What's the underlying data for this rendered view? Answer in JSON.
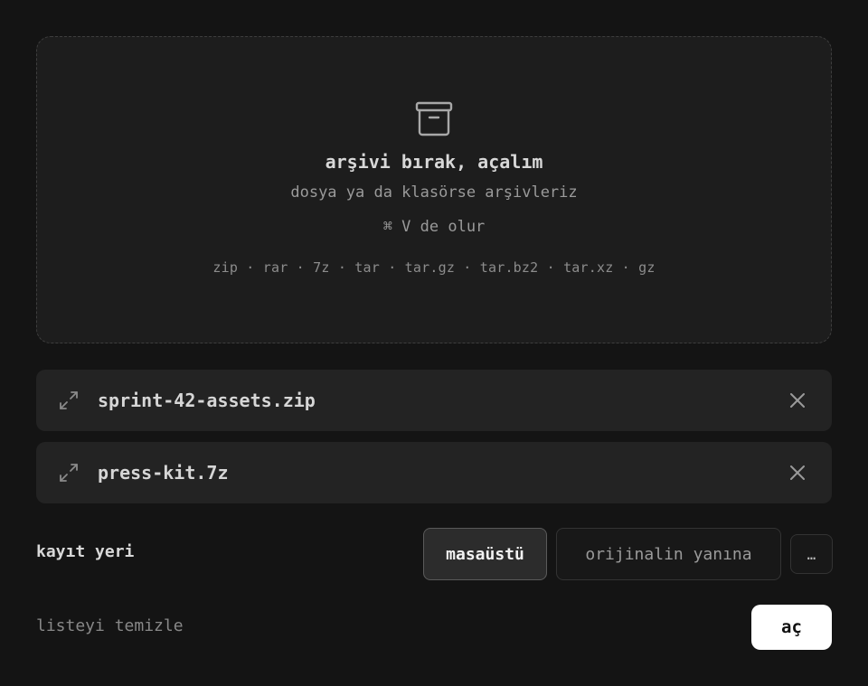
{
  "dropzone": {
    "icon": "archive-box-icon",
    "title": "arşivi bırak, açalım",
    "subtitle": "dosya ya da klasörse arşivleriz",
    "paste_hint": "⌘ V de olur",
    "formats": "zip · rar · 7z · tar · tar.gz · tar.bz2 · tar.xz · gz"
  },
  "files": [
    {
      "name": "sprint-42-assets.zip",
      "expand_icon": "expand-arrows-icon",
      "remove_icon": "close-icon"
    },
    {
      "name": "press-kit.7z",
      "expand_icon": "expand-arrows-icon",
      "remove_icon": "close-icon"
    }
  ],
  "save": {
    "label": "kayıt yeri",
    "options": [
      {
        "label": "masaüstü",
        "selected": true
      },
      {
        "label": "orijinalin yanına",
        "selected": false
      }
    ],
    "more_label": "…"
  },
  "footer": {
    "clear_label": "listeyi temizle",
    "open_label": "aç"
  },
  "colors": {
    "background": "#141414",
    "dropzone_bg": "#1d1d1d",
    "row_bg": "#232323",
    "primary_button_bg": "#ffffff"
  }
}
